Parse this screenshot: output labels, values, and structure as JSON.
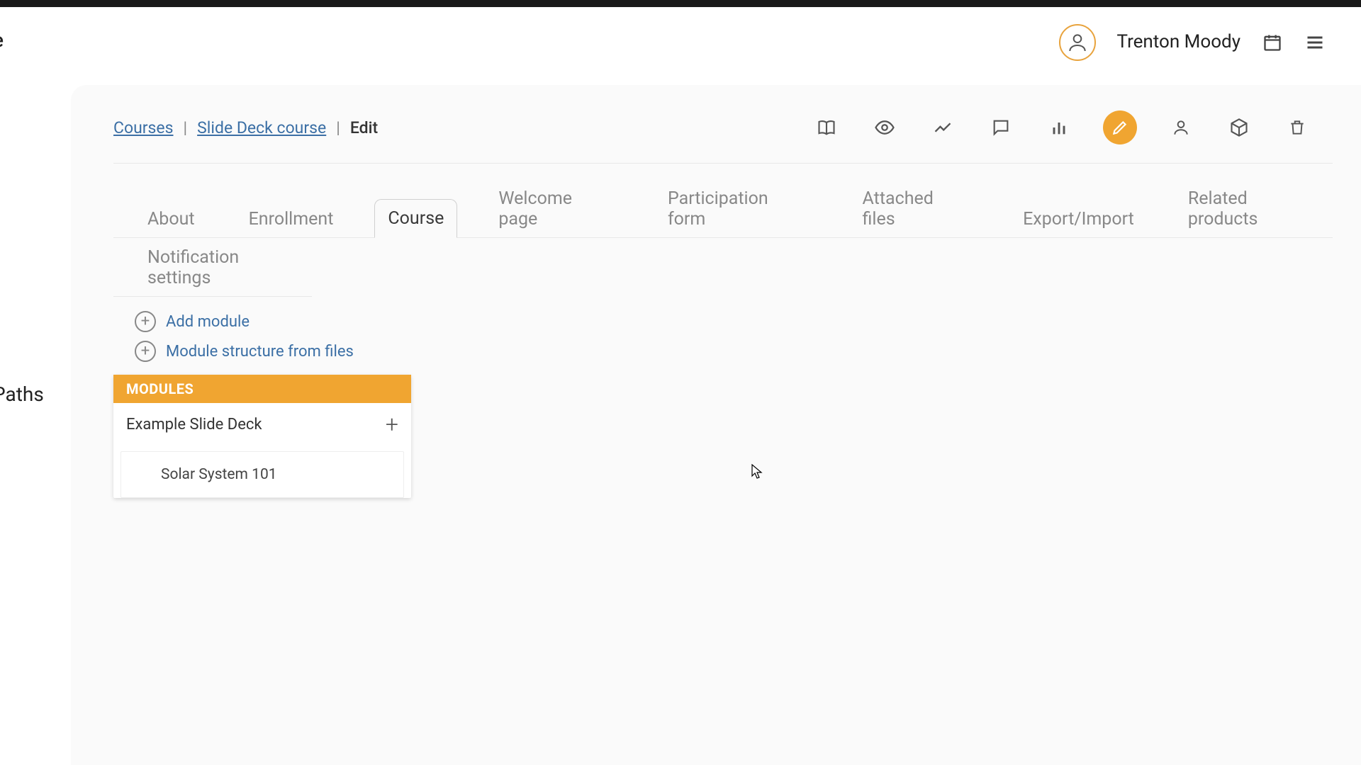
{
  "user": {
    "name": "Trenton Moody"
  },
  "leftnav": {
    "peek": "e",
    "paths": "Paths"
  },
  "breadcrumb": {
    "root": "Courses",
    "course": "Slide Deck course",
    "current": "Edit"
  },
  "tabs": {
    "row1": [
      "About",
      "Enrollment",
      "Course",
      "Welcome page",
      "Participation form",
      "Attached files",
      "Export/Import",
      "Related products"
    ],
    "row2": [
      "Notification settings"
    ],
    "active": "Course"
  },
  "module_actions": {
    "add_module": "Add module",
    "from_files": "Module structure from files"
  },
  "modules": {
    "header": "MODULES",
    "list": [
      {
        "title": "Example Slide Deck",
        "items": [
          "Solar System 101"
        ]
      }
    ]
  }
}
